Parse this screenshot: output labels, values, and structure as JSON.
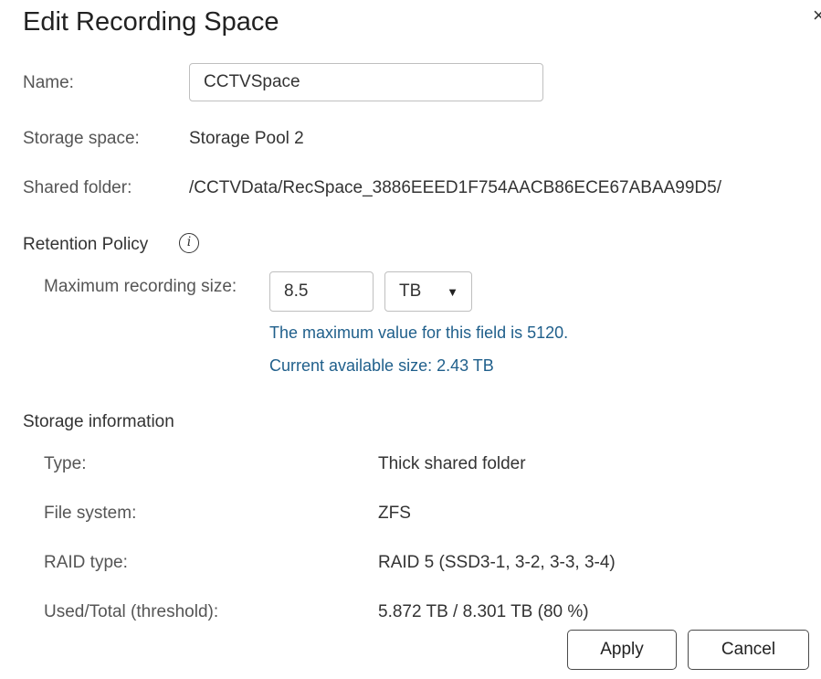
{
  "dialog": {
    "title": "Edit Recording Space",
    "close_glyph": "×"
  },
  "general": {
    "name_label": "Name:",
    "name_value": "CCTVSpace",
    "storage_space_label": "Storage space:",
    "storage_space_value": "Storage Pool 2",
    "shared_folder_label": "Shared folder:",
    "shared_folder_value": "/CCTVData/RecSpace_3886EEED1F754AACB86ECE67ABAA99D5/"
  },
  "retention": {
    "heading": "Retention Policy",
    "info_glyph": "i",
    "max_size_label": "Maximum recording size:",
    "max_size_value": "8.5",
    "unit_value": "TB",
    "hint_max": "The maximum value for this field is 5120.",
    "hint_available": "Current available size: 2.43 TB"
  },
  "storage_info": {
    "heading": "Storage information",
    "rows": [
      {
        "label": "Type:",
        "value": "Thick shared folder"
      },
      {
        "label": "File system:",
        "value": "ZFS"
      },
      {
        "label": "RAID type:",
        "value": "RAID 5 (SSD3-1, 3-2, 3-3, 3-4)"
      },
      {
        "label": "Used/Total (threshold):",
        "value": "5.872 TB / 8.301 TB (80 %)"
      }
    ]
  },
  "buttons": {
    "apply": "Apply",
    "cancel": "Cancel"
  },
  "colors": {
    "hint_text": "#1f5f8b",
    "border": "#bfbfbf"
  }
}
